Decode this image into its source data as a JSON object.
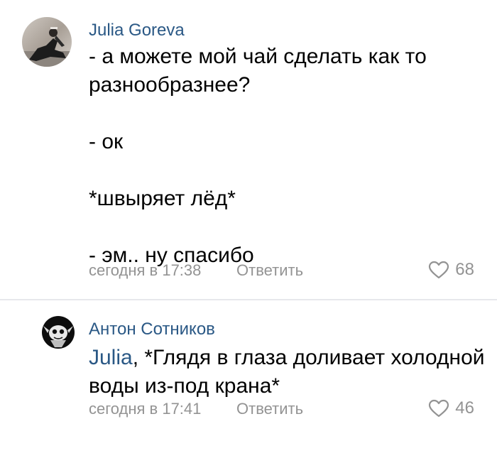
{
  "comments": [
    {
      "author": "Julia Goreva",
      "lines": [
        "- а можете мой чай сделать как то разнообразнее?",
        "",
        "- ок",
        "",
        "*швыряет лёд*",
        "",
        "- эм.. ну спасибо"
      ],
      "time": "сегодня в 17:38",
      "reply_label": "Ответить",
      "likes": "68"
    },
    {
      "author": "Антон Сотников",
      "mention": "Julia",
      "text": ", *Глядя в глаза доливает холодной воды из-под крана*",
      "time": "сегодня в 17:41",
      "reply_label": "Ответить",
      "likes": "46"
    }
  ],
  "colors": {
    "link": "#2a5885",
    "meta": "#939393",
    "divider": "#e7e8ec"
  },
  "icons": [
    "heart-icon"
  ]
}
